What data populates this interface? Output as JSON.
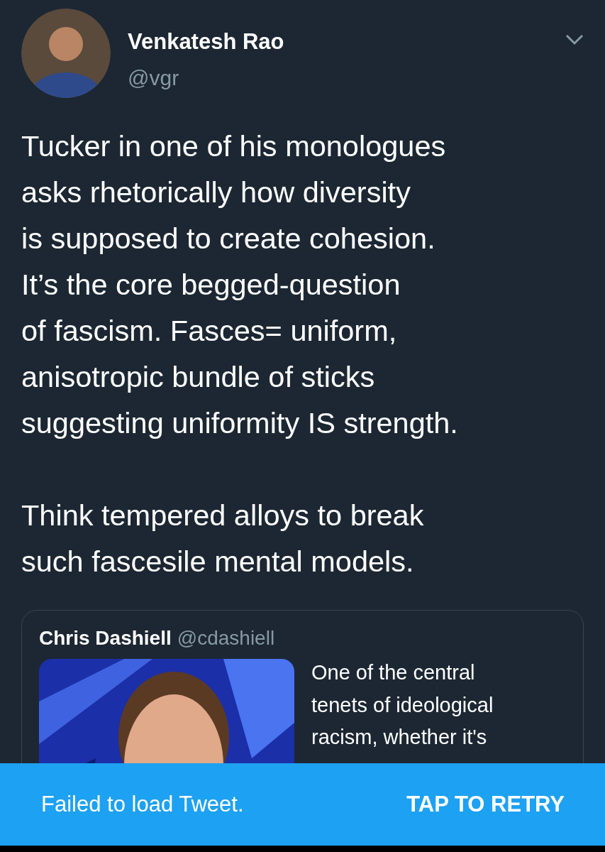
{
  "author": {
    "name": "Venkatesh Rao",
    "handle": "@vgr"
  },
  "tweet": {
    "paragraphs": [
      "Tucker in one of his monologues\nasks rhetorically how diversity\nis supposed to create cohesion.\nIt’s the core begged-question\nof fascism. Fasces= uniform,\nanisotropic bundle of sticks\nsuggesting uniformity IS strength.",
      "Think tempered alloys to break\nsuch fascesile mental models."
    ]
  },
  "quoted_tweet": {
    "name": "Chris Dashiell",
    "handle": "@cdashiell",
    "text": "One of the central\ntenets of ideological\nracism, whether it's"
  },
  "snackbar": {
    "message": "Failed to load Tweet.",
    "action": "TAP TO RETRY"
  }
}
